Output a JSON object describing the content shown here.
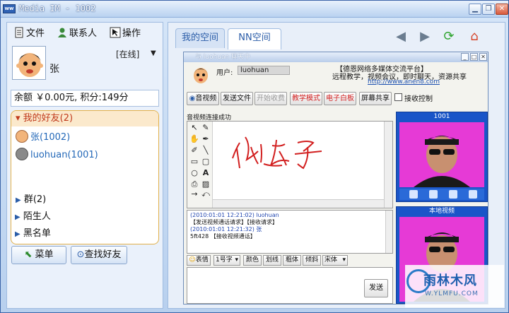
{
  "window": {
    "title": "Media IM - 1002",
    "app_badge": "ww"
  },
  "left": {
    "toolbar": [
      {
        "label": "文件"
      },
      {
        "label": "联系人"
      },
      {
        "label": "操作"
      }
    ],
    "user": {
      "name": "张",
      "status": "[在线]"
    },
    "balance": "余额 ￥0.00元, 积分:149分",
    "friends_group": "我的好友(2)",
    "friends": [
      {
        "name": "张(1002)"
      },
      {
        "name": "luohuan(1001)"
      }
    ],
    "groups": [
      "群(2)",
      "陌生人",
      "黑名单"
    ],
    "buttons": {
      "menu": "菜单",
      "find": "查找好友"
    }
  },
  "right": {
    "tabs": [
      "我的空间",
      "NN空间"
    ]
  },
  "chat": {
    "title": "与 luohuan 聊天中",
    "user_label": "用户:",
    "user_value": "luohuan",
    "banner": [
      "【德恩网络多媒体交流平台】",
      "远程教学，视频会议，即时聊天，资源共享",
      "http://www.anen8.com"
    ],
    "buttons": [
      {
        "label": "音视频",
        "style": "normal"
      },
      {
        "label": "发送文件",
        "style": "normal"
      },
      {
        "label": "开始收费",
        "style": "dis"
      },
      {
        "label": "教学模式",
        "style": "red"
      },
      {
        "label": "电子白板",
        "style": "red"
      },
      {
        "label": "屏幕共享",
        "style": "normal"
      }
    ],
    "receive_control": "接收控制",
    "video_status": "音视频连接成功",
    "whiteboard_text": "你好",
    "log": [
      {
        "meta": "(2010:01:01 12:21:02) luohuan",
        "text": "【发送视频通话请求】【接收请求】"
      },
      {
        "meta": "(2010:01:01 12:21:32) 张",
        "text": "5ft428 【接收视频通话】"
      }
    ],
    "format": {
      "emoji": "表情",
      "size": "1号字",
      "color": "颜色",
      "underline": "划线",
      "bold": "粗体",
      "italic": "倾斜",
      "font": "宋体"
    },
    "send": "发送",
    "video_remote_title": "1001",
    "video_local_title": "本地视频"
  },
  "watermark": {
    "text": "雨林木风",
    "url": "W.YLMFU.COM"
  },
  "colors": {
    "accent": "#2b5da8",
    "video_bg": "#e63ad6",
    "alert": "#c0391b"
  }
}
